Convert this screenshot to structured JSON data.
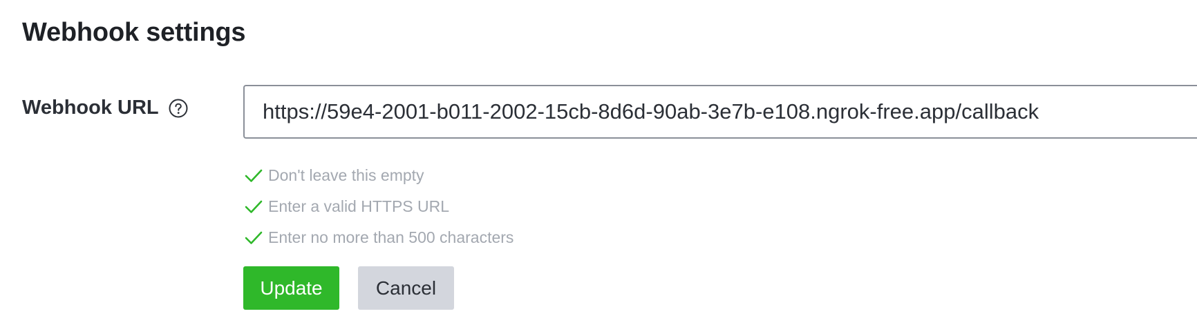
{
  "section": {
    "title": "Webhook settings"
  },
  "webhook_url": {
    "label": "Webhook URL",
    "help_icon": "question-circle-icon",
    "value": "https://59e4-2001-b011-2002-15cb-8d6d-90ab-3e7b-e108.ngrok-free.app/callback"
  },
  "validation": {
    "icon": "check-icon",
    "color": "#2fb82a",
    "rules": [
      {
        "text": "Don't leave this empty",
        "passed": true
      },
      {
        "text": "Enter a valid HTTPS URL",
        "passed": true
      },
      {
        "text": "Enter no more than 500 characters",
        "passed": true
      }
    ]
  },
  "actions": {
    "update_label": "Update",
    "cancel_label": "Cancel"
  },
  "colors": {
    "primary": "#2fb82a",
    "secondary": "#d3d6dd",
    "rule_text": "#a3a8b0"
  }
}
